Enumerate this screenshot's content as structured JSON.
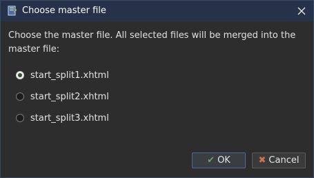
{
  "window": {
    "title": "Choose master file",
    "icon": "book-icon"
  },
  "message": "Choose the master file. All selected files will be merged into the master file:",
  "options": [
    {
      "label": "start_split1.xhtml",
      "checked": true
    },
    {
      "label": "start_split2.xhtml",
      "checked": false
    },
    {
      "label": "start_split3.xhtml",
      "checked": false
    }
  ],
  "buttons": {
    "ok": {
      "label": "OK",
      "icon": "check-icon"
    },
    "cancel": {
      "label": "Cancel",
      "icon": "x-icon"
    }
  },
  "colors": {
    "titlebar": "#25324a",
    "background": "#2d2d2d",
    "ok_border": "#4a6da0"
  }
}
